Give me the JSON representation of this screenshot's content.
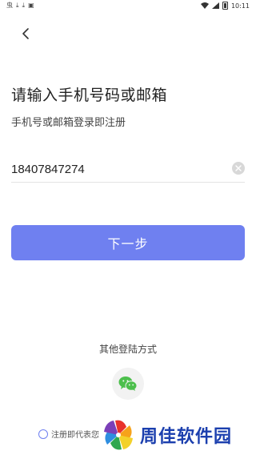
{
  "status_bar": {
    "left_icons": [
      "notification-icon",
      "download-icon",
      "download-icon",
      "sim-icon"
    ],
    "time": "10:11"
  },
  "title": "请输入手机号码或邮箱",
  "subtitle": "手机号或邮箱登录即注册",
  "phone": {
    "value": "18407847274"
  },
  "next_button": "下一步",
  "other_login": {
    "label": "其他登陆方式",
    "methods": [
      "wechat-icon"
    ]
  },
  "agreement": {
    "text": "注册即代表您"
  },
  "watermark": {
    "text": "周佳软件园"
  },
  "colors": {
    "accent": "#6f80f0",
    "wechat": "#4cbf4c",
    "watermark": "#1b3fae"
  }
}
